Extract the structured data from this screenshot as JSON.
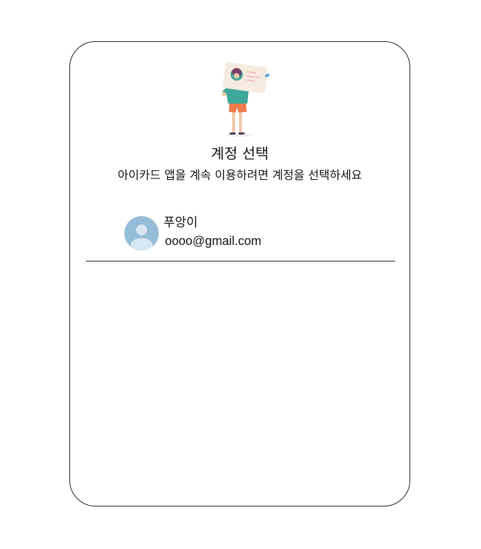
{
  "dialog": {
    "title": "계정 선택",
    "subtitle": "아이카드 앱을 계속 이용하려면 계정을 선택하세요"
  },
  "accounts": [
    {
      "name": "푸앙이",
      "email": "oooo@gmail.com",
      "avatar_icon": "default-user-avatar-icon"
    }
  ],
  "colors": {
    "card_border": "#1a1a1a",
    "avatar_bg": "#96bdd8",
    "avatar_fg": "#d6e6f2",
    "illustration_card": "#f6ebdf",
    "illustration_shirt": "#3fa89a",
    "illustration_shorts": "#f07a4a",
    "illustration_hair": "#7a3e6a"
  },
  "illustration": {
    "icon": "person-holding-id-card-illustration"
  }
}
